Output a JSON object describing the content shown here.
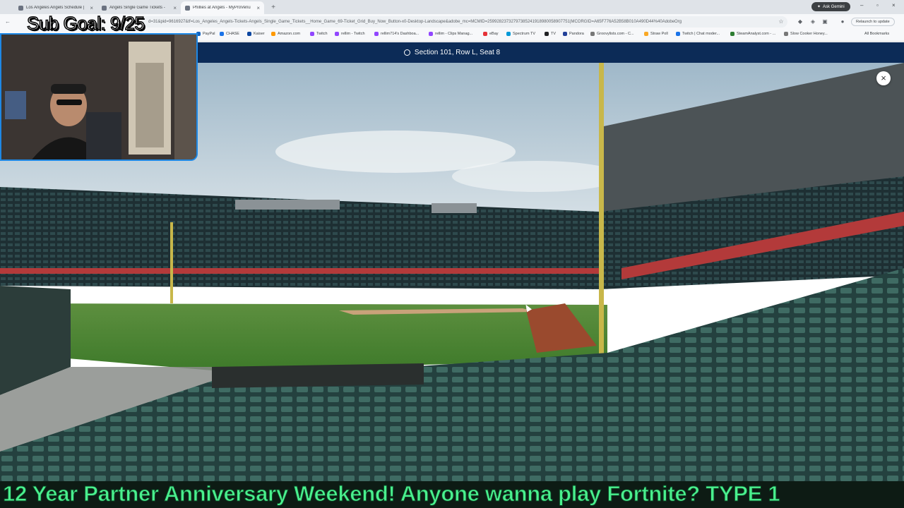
{
  "browser": {
    "tabs": [
      {
        "title": "Los Angeles Angels Schedule |",
        "active": false
      },
      {
        "title": "Angels Single Game Tickets - ",
        "active": false
      },
      {
        "title": "Phillies at Angels - MyProVenu",
        "active": true
      }
    ],
    "new_tab": "+",
    "ask_gemini": "Ask Gemini",
    "url": "d=31&pid=9616927&tf=Los_Angeles_Angels-Tickets-Angels_Single_Game_Tickets__Home_Game_69-Ticket_Grid_Buy_Now_Button-x0-Desktop-Landscape&adobe_mc=MCMID=25992823732797385241918980058907751|MCORGID=A65F776A52B58B010A490D44%40AdobeOrg",
    "relaunch_label": "Relaunch to update",
    "bookmarks": [
      {
        "label": "PayPal",
        "color": "#1565c0"
      },
      {
        "label": "CHASE",
        "color": "#1a73e8"
      },
      {
        "label": "Kaiser",
        "color": "#0d47a1"
      },
      {
        "label": "Amazon.com",
        "color": "#ff9900"
      },
      {
        "label": "Twitch",
        "color": "#9146ff"
      },
      {
        "label": "rellim - Twitch",
        "color": "#9146ff"
      },
      {
        "label": "rellim714's Dashboa...",
        "color": "#9146ff"
      },
      {
        "label": "rellim - Clips Manag...",
        "color": "#9146ff"
      },
      {
        "label": "eBay",
        "color": "#e53238"
      },
      {
        "label": "Spectrum TV",
        "color": "#0099d8"
      },
      {
        "label": "TV",
        "color": "#202124"
      },
      {
        "label": "Pandora",
        "color": "#224099"
      },
      {
        "label": "Groovylists.com - C...",
        "color": "#777777"
      },
      {
        "label": "Straw Poll",
        "color": "#f9a825"
      },
      {
        "label": "Twitch | Chat moder...",
        "color": "#1a73e8"
      },
      {
        "label": "SteamAnalyst.com - ...",
        "color": "#2e7d32"
      },
      {
        "label": "Slow Cooker Honey...",
        "color": "#777777"
      }
    ],
    "all_bookmarks": "All Bookmarks"
  },
  "venue": {
    "seat_label": "Section 101, Row L, Seat 8",
    "header_color": "#0c2b57",
    "close_label": "×"
  },
  "stream": {
    "sub_goal": "Sub Goal: 9/25",
    "ticker": "12 Year Partner Anniversary Weekend! Anyone wanna play Fortnite? TYPE 1",
    "ticker_color": "#4af08e"
  }
}
